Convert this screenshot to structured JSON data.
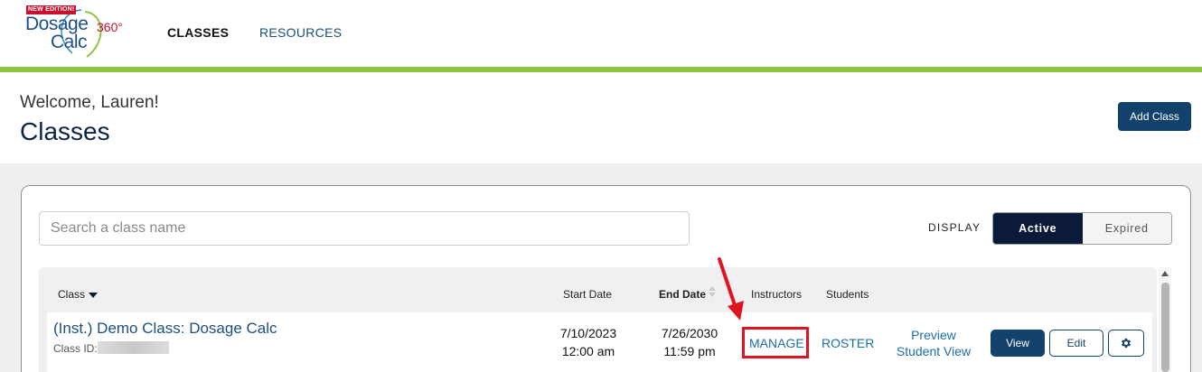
{
  "logo": {
    "badge": "NEW EDITION!",
    "word1": "Dosage",
    "word2": "Calc",
    "suffix": "360°"
  },
  "nav": {
    "classes": "CLASSES",
    "resources": "RESOURCES"
  },
  "header": {
    "welcome": "Welcome, Lauren!",
    "title": "Classes",
    "add_class": "Add Class"
  },
  "search": {
    "placeholder": "Search a class name"
  },
  "display": {
    "label": "DISPLAY",
    "active": "Active",
    "expired": "Expired",
    "selected": "Active"
  },
  "table": {
    "columns": {
      "class": "Class",
      "start_date": "Start Date",
      "end_date": "End Date",
      "instructors": "Instructors",
      "students": "Students"
    },
    "rows": [
      {
        "name": "(Inst.) Demo Class: Dosage Calc",
        "class_id_label": "Class ID:",
        "start_date": "7/10/2023",
        "start_time": "12:00 am",
        "end_date": "7/26/2030",
        "end_time": "11:59 pm",
        "manage": "MANAGE",
        "roster": "ROSTER",
        "preview_line1": "Preview",
        "preview_line2": "Student View",
        "view": "View",
        "edit": "Edit"
      }
    ]
  },
  "colors": {
    "brand_navy": "#12426b",
    "accent_green": "#8dc63f",
    "highlight_red": "#e0141e",
    "link_blue": "#1b6fa8"
  },
  "icons": {
    "sort": "sort-caret-icon",
    "settings": "gear-icon",
    "annotation": "red-arrow-icon"
  }
}
